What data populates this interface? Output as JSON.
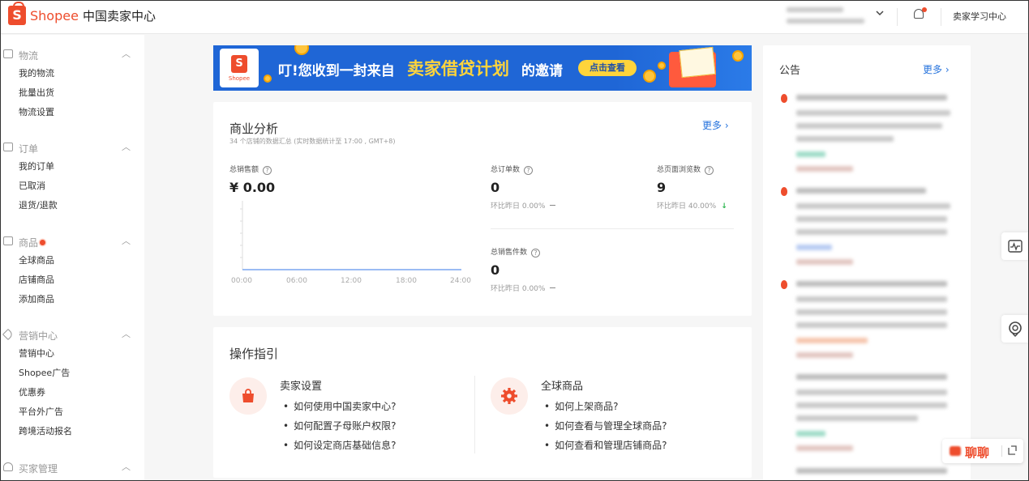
{
  "header": {
    "brand": "Shopee",
    "brand_sub": "中国卖家中心",
    "learning_center": "卖家学习中心",
    "logo_glyph": "S"
  },
  "sidebar": {
    "groups": [
      {
        "title": "物流",
        "items": [
          "我的物流",
          "批量出货",
          "物流设置"
        ]
      },
      {
        "title": "订单",
        "items": [
          "我的订单",
          "已取消",
          "退货/退款"
        ]
      },
      {
        "title": "商品",
        "items": [
          "全球商品",
          "店铺商品",
          "添加商品"
        ]
      },
      {
        "title": "营销中心",
        "items": [
          "营销中心",
          "Shopee广告",
          "优惠券",
          "平台外广告",
          "跨境活动报名"
        ]
      },
      {
        "title": "买家管理",
        "items": []
      }
    ]
  },
  "banner": {
    "shop_name": "Shopee",
    "text_part1": "叮!您收到一封来自",
    "text_highlight": "卖家借贷计划",
    "text_part3": "的邀请",
    "button": "点击查看"
  },
  "analytics": {
    "title": "商业分析",
    "more": "更多 ›",
    "subtitle": "34 个店铺的数据汇总 (实时数据统计至 17:00 , GMT+8)",
    "sales_label": "总销售额",
    "sales_value": "¥ 0.00",
    "x_ticks": [
      "00:00",
      "06:00",
      "12:00",
      "18:00",
      "24:00"
    ],
    "orders_label": "总订单数",
    "orders_value": "0",
    "orders_cmp": "环比昨日 0.00%",
    "pageviews_label": "总页面浏览数",
    "pageviews_value": "9",
    "pageviews_cmp": "环比昨日 40.00%",
    "units_label": "总销售件数",
    "units_value": "0",
    "units_cmp": "环比昨日 0.00%",
    "help_glyph": "?",
    "down_glyph": "↓"
  },
  "guide": {
    "title": "操作指引",
    "sections": [
      {
        "title": "卖家设置",
        "items": [
          "如何使用中国卖家中心?",
          "如何配置子母账户权限?",
          "如何设定商店基础信息?"
        ]
      },
      {
        "title": "全球商品",
        "items": [
          "如何上架商品?",
          "如何查看与管理全球商品?",
          "如何查看和管理店铺商品?"
        ]
      }
    ]
  },
  "announcements": {
    "title": "公告",
    "more": "更多 ›"
  },
  "chat": {
    "label": "聊聊"
  }
}
